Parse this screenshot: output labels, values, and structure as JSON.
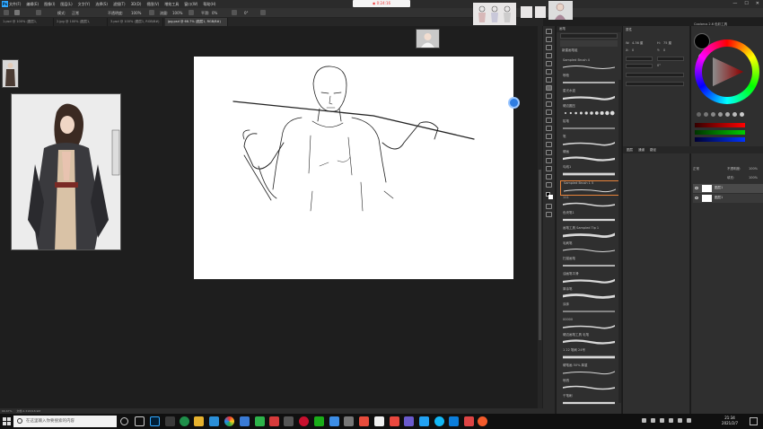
{
  "menubar": {
    "logo": "Ps",
    "menus": [
      "文件(F)",
      "编辑(E)",
      "图像(I)",
      "图层(L)",
      "文字(Y)",
      "选择(S)",
      "滤镜(T)",
      "3D(D)",
      "视图(V)",
      "增效工具",
      "窗口(W)",
      "帮助(H)"
    ],
    "recording": "◉ 0:24:16",
    "controls": [
      "—",
      "☐",
      "✕"
    ]
  },
  "options": {
    "mode_label": "模式:",
    "mode_value": "正常",
    "opacity_label": "不透明度:",
    "opacity_value": "100%",
    "flow_label": "流量:",
    "flow_value": "100%",
    "smooth_label": "平滑:",
    "smooth_value": "0%",
    "angle_value": "0°"
  },
  "tabs": [
    {
      "label": "1.psd @ 100% (图层1, RGB/8#)",
      "active": false
    },
    {
      "label": "2.jpg @ 100% (图层1, RGB/8#)",
      "active": false
    },
    {
      "label": "3.psd @ 100% (图层1, RGB/8#)",
      "active": false
    },
    {
      "label": "jpg.psd @ 66.7% (图层1, RGB/8#)",
      "active": true
    }
  ],
  "brush_panel": {
    "header": "画笔",
    "group_title": "新建画笔组",
    "brushes": [
      {
        "name": "Sampled Brush 4",
        "selected": false
      },
      {
        "name": "喷枪",
        "selected": false
      },
      {
        "name": "星光水迹",
        "selected": false
      },
      {
        "name": "硬边圆压",
        "selected": false
      },
      {
        "name": "铅笔",
        "selected": false
      },
      {
        "name": "笔",
        "selected": false
      },
      {
        "name": "硬画",
        "selected": false
      },
      {
        "name": "勾线1",
        "selected": false
      },
      {
        "name": "Sampled Brush 1 5",
        "selected": true
      },
      {
        "name": "111",
        "selected": false
      },
      {
        "name": "色块笔1",
        "selected": false
      },
      {
        "name": "画笔工具 Sampled Tip 1",
        "selected": false
      },
      {
        "name": "毛刷笔",
        "selected": false
      },
      {
        "name": "扫描画笔",
        "selected": false
      },
      {
        "name": "油画笔平滑",
        "selected": false
      },
      {
        "name": "厚涂笔",
        "selected": false
      },
      {
        "name": "涂抹",
        "selected": false
      },
      {
        "name": "00000",
        "selected": false
      },
      {
        "name": "硬边画笔工具 毛笔",
        "selected": false
      },
      {
        "name": "1 22 笔刷 24号",
        "selected": false
      },
      {
        "name": "硬笔画 50% 厚重",
        "selected": false
      },
      {
        "name": "喷溅",
        "selected": false
      },
      {
        "name": "干笔刷",
        "selected": false
      }
    ]
  },
  "properties": {
    "title": "属性",
    "w_label": "W:",
    "w_value": "4.36 厘",
    "h_label": "H:",
    "h_value": "75 厘",
    "x_label": "X:",
    "x_value": "0",
    "y_label": "Y:",
    "y_value": "0",
    "angle": "0°"
  },
  "layers": {
    "tabs": [
      "图层",
      "通道",
      "路径"
    ],
    "blend": "正常",
    "opacity_label": "不透明度:",
    "opacity_value": "100%",
    "fill_label": "填充:",
    "fill_value": "100%",
    "items": [
      {
        "name": "图层1",
        "visible": true
      },
      {
        "name": "图层1",
        "visible": true
      }
    ]
  },
  "color_panel": {
    "title": "Coolorus 2.6 色彩工具",
    "accent_colors": [
      "#ff0000",
      "#00c000",
      "#0033ff"
    ]
  },
  "status": {
    "zoom": "66.67%",
    "doc": "文档:2.31M/18.9M"
  },
  "taskbar": {
    "search_placeholder": "在这里输入你要搜索的内容",
    "time": "21:34",
    "date": "2021/2/7"
  }
}
